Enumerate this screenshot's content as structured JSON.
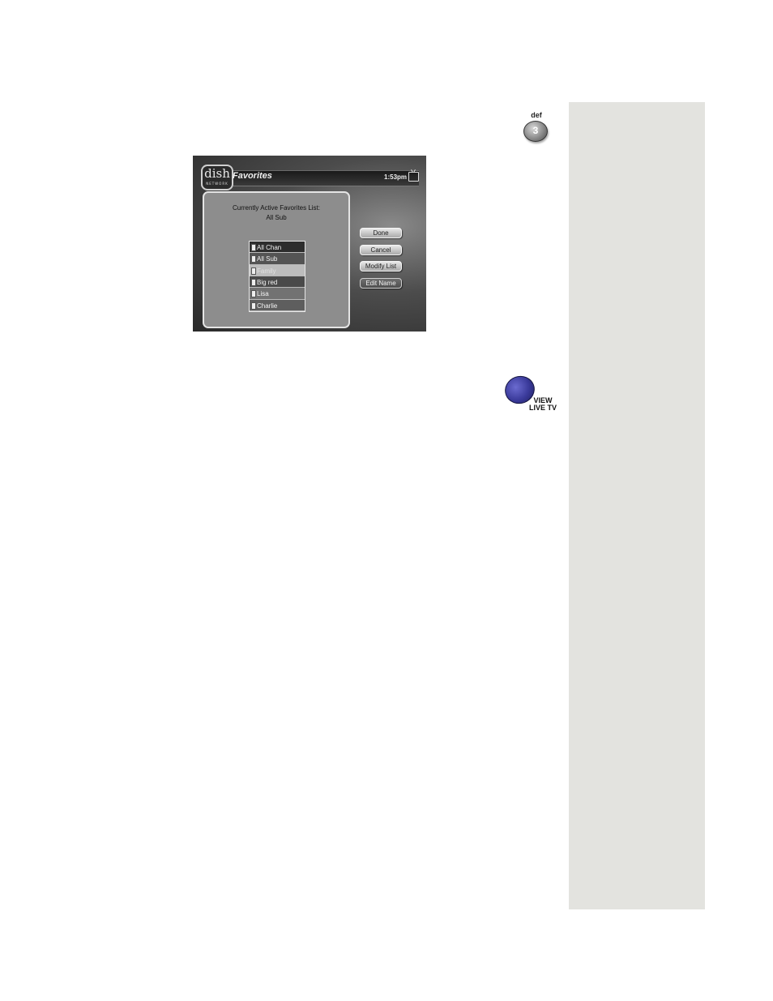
{
  "remote": {
    "def_key": {
      "letters": "def",
      "number": "3"
    },
    "live_key": {
      "line1": "VIEW",
      "line2": "LIVE TV"
    }
  },
  "screen": {
    "logo": {
      "text": "dish",
      "sub": "NETWORK"
    },
    "title": "Favorites",
    "clock": "1:53pm",
    "panel": {
      "heading_line1": "Currently Active Favorites List:",
      "heading_line2": "All Sub",
      "items": [
        {
          "label": "All Chan"
        },
        {
          "label": "All Sub"
        },
        {
          "label": "Family"
        },
        {
          "label": "Big red"
        },
        {
          "label": "Lisa"
        },
        {
          "label": "Charlie"
        }
      ]
    },
    "buttons": {
      "done": "Done",
      "cancel": "Cancel",
      "modify_list": "Modify List",
      "edit_name": "Edit Name"
    }
  },
  "colors": {
    "sidebar": "#e3e3df",
    "live_tv_button": "#3a3a9a"
  }
}
